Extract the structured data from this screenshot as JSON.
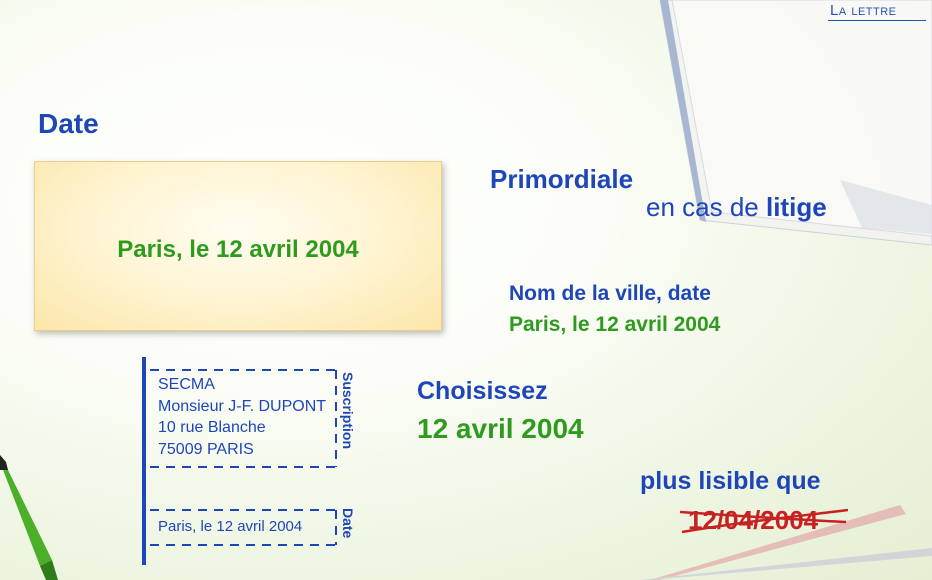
{
  "header": {
    "brand": "La lettre"
  },
  "section_title": "Date",
  "date_box": {
    "text": "Paris, le 12 avril 2004"
  },
  "importance": {
    "line1": "Primordiale",
    "line2_prefix": "en cas de ",
    "line2_emphasis": "litige"
  },
  "format": {
    "label": "Nom de la ville, date",
    "example": "Paris, le 12 avril 2004"
  },
  "choice": {
    "label": "Choisissez",
    "value": "12 avril 2004"
  },
  "comparison": {
    "label": "plus lisible que",
    "crossed_out": "12/04/2004"
  },
  "letter_diagram": {
    "suscription_label": "Suscription",
    "date_label": "Date",
    "address_lines": [
      "SECMA",
      "Monsieur J-F. DUPONT",
      "10 rue Blanche",
      "75009 PARIS"
    ],
    "date_text": "Paris, le 12 avril 2004"
  },
  "colors": {
    "blue": "#1e46b8",
    "green": "#2e9b1f",
    "red": "#c62222",
    "box_fill": "#fff3cf"
  }
}
